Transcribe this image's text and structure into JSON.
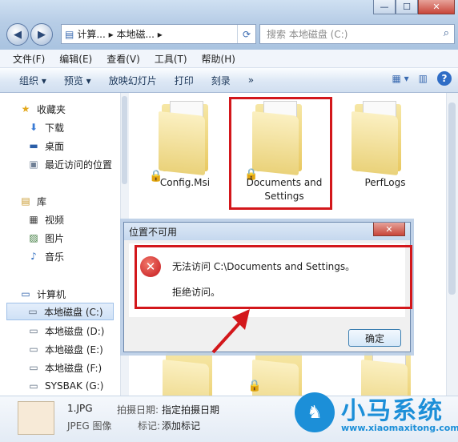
{
  "window": {
    "minimize_label": "—",
    "maximize_label": "☐",
    "close_label": "✕"
  },
  "nav": {
    "back_icon": "◀",
    "forward_icon": "▶",
    "address": "计算... ▸ 本地磁... ▸",
    "refresh_icon": "⟳",
    "search_placeholder": "搜索 本地磁盘 (C:)",
    "search_icon": "⌕"
  },
  "menu": [
    "文件(F)",
    "编辑(E)",
    "查看(V)",
    "工具(T)",
    "帮助(H)"
  ],
  "toolbar": {
    "organize": "组织 ▾",
    "preview": "预览 ▾",
    "slideshow": "放映幻灯片",
    "print": "打印",
    "burn": "刻录",
    "more": "»",
    "help": "?"
  },
  "sidebar": {
    "favorites": {
      "header": "收藏夹",
      "items": [
        "下载",
        "桌面",
        "最近访问的位置"
      ]
    },
    "library": {
      "header": "库",
      "items": [
        "视频",
        "图片",
        "音乐"
      ]
    },
    "computer": {
      "header": "计算机",
      "items": [
        "本地磁盘 (C:)",
        "本地磁盘 (D:)",
        "本地磁盘 (E:)",
        "本地磁盘 (F:)",
        "SYSBAK (G:)"
      ],
      "selected_index": 0
    }
  },
  "files": [
    {
      "name": "Config.Msi",
      "locked": true
    },
    {
      "name": "Documents and Settings",
      "locked": true,
      "highlighted": true
    },
    {
      "name": "PerfLogs",
      "locked": false
    }
  ],
  "dialog": {
    "title": "位置不可用",
    "close_label": "✕",
    "message": "无法访问 C:\\Documents and Settings。",
    "detail": "拒绝访问。",
    "ok_label": "确定"
  },
  "details_pane": {
    "filename": "1.JPG",
    "filetype": "JPEG 图像",
    "date_label": "拍摄日期:",
    "date_value": "指定拍摄日期",
    "tag_label": "标记:",
    "tag_value": "添加标记"
  },
  "watermark": {
    "brand": "小马系统",
    "url": "www.xiaomaxitong.com"
  },
  "colors": {
    "highlight_red": "#d3171b",
    "brand_blue": "#1c8fd8"
  }
}
